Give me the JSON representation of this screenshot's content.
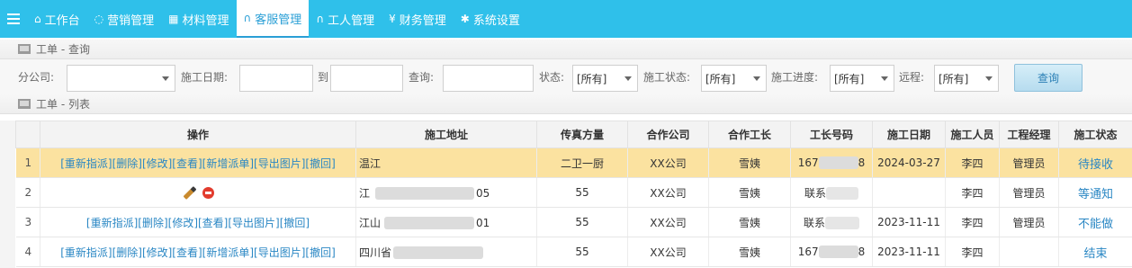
{
  "nav": {
    "items": [
      {
        "icon": "home-icon",
        "glyph": "⌂",
        "label": "工作台"
      },
      {
        "icon": "chat-icon",
        "glyph": "◌",
        "label": "营销管理"
      },
      {
        "icon": "grid-icon",
        "glyph": "▦",
        "label": "材料管理"
      },
      {
        "icon": "headset-icon",
        "glyph": "∩",
        "label": "客服管理"
      },
      {
        "icon": "headset-icon",
        "glyph": "∩",
        "label": "工人管理"
      },
      {
        "icon": "yen-icon",
        "glyph": "¥",
        "label": "财务管理"
      },
      {
        "icon": "gear-icon",
        "glyph": "✱",
        "label": "系统设置"
      }
    ],
    "active": "客服管理"
  },
  "query_section": {
    "title": "工单 - 查询"
  },
  "list_section": {
    "title": "工单 - 列表"
  },
  "filters": {
    "company_label": "分公司:",
    "company_value": "",
    "date_label": "施工日期:",
    "date_from": "",
    "to_label": "到",
    "date_to": "",
    "search_label": "查询:",
    "search_value": "",
    "status_label": "状态:",
    "status_value": "[所有]",
    "build_status_label": "施工状态:",
    "build_status_value": "[所有]",
    "progress_label": "施工进度:",
    "progress_value": "[所有]",
    "remote_label": "远程:",
    "remote_value": "[所有]",
    "query_button": "查询"
  },
  "table": {
    "headers": [
      "",
      "操作",
      "施工地址",
      "传真方量",
      "合作公司",
      "合作工长",
      "工长号码",
      "施工日期",
      "施工人员",
      "工程经理",
      "施工状态"
    ],
    "rows": [
      {
        "no": "1",
        "ops": "[重新指派][删除][修改][查看][新增派单][导出图片][撤回]",
        "addr": "温江",
        "fax": "二卫一厨",
        "company": "XX公司",
        "foreman": "雪姨",
        "phone_a": "167",
        "phone_b": "8",
        "date": "2024-03-27",
        "worker": "李四",
        "manager": "管理员",
        "status": "待接收"
      },
      {
        "no": "2",
        "ops": "",
        "addr": "江",
        "addr_tail": "05",
        "fax": "55",
        "company": "XX公司",
        "foreman": "雪姨",
        "phone_a": "联系",
        "phone_b": "",
        "date": "",
        "worker": "李四",
        "manager": "管理员",
        "status": "等通知"
      },
      {
        "no": "3",
        "ops": "[重新指派][删除][修改][查看][导出图片][撤回]",
        "addr": "江山",
        "addr_tail": "01",
        "fax": "55",
        "company": "XX公司",
        "foreman": "雪姨",
        "phone_a": "联系",
        "phone_b": "",
        "date": "2023-11-11",
        "worker": "李四",
        "manager": "管理员",
        "status": "不能做"
      },
      {
        "no": "4",
        "ops": "[重新指派][删除][修改][查看][新增派单][导出图片][撤回]",
        "addr": "四川省",
        "addr_tail": "",
        "fax": "55",
        "company": "XX公司",
        "foreman": "雪姨",
        "phone_a": "167",
        "phone_b": "8",
        "date": "2023-11-11",
        "worker": "李四",
        "manager": "",
        "status": "结束"
      }
    ]
  }
}
